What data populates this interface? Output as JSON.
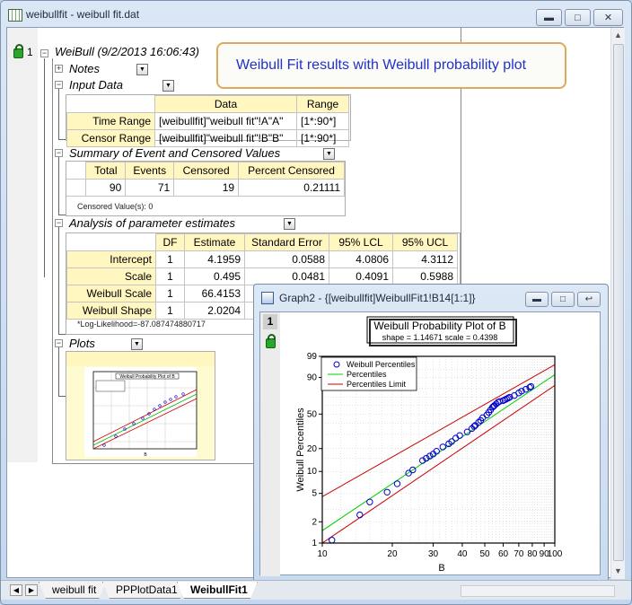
{
  "window": {
    "title": "weibullfit - weibull fit.dat"
  },
  "tree": {
    "root_index": "1",
    "root_label": "WeiBull (9/2/2013 16:06:43)",
    "notes": "Notes",
    "input_data": {
      "title": "Input Data",
      "headers": [
        "Data",
        "Range"
      ],
      "rows": [
        {
          "label": "Time Range",
          "data": "[weibullfit]\"weibull fit\"!A\"A\"",
          "range": "[1*:90*]"
        },
        {
          "label": "Censor Range",
          "data": "[weibullfit]\"weibull fit\"!B\"B\"",
          "range": "[1*:90*]"
        }
      ]
    },
    "summary": {
      "title": "Summary of Event and Censored Values",
      "headers": [
        "Total",
        "Events",
        "Censored",
        "Percent Censored"
      ],
      "values": [
        "90",
        "71",
        "19",
        "0.21111"
      ],
      "note": "Censored Value(s): 0"
    },
    "analysis": {
      "title": "Analysis of parameter estimates",
      "headers": [
        "DF",
        "Estimate",
        "Standard Error",
        "95% LCL",
        "95% UCL"
      ],
      "rows": [
        {
          "label": "Intercept",
          "cells": [
            "1",
            "4.1959",
            "0.0588",
            "4.0806",
            "4.3112"
          ]
        },
        {
          "label": "Scale",
          "cells": [
            "1",
            "0.495",
            "0.0481",
            "0.4091",
            "0.5988"
          ]
        },
        {
          "label": "Weibull Scale",
          "cells": [
            "1",
            "66.4153",
            "",
            "",
            ""
          ]
        },
        {
          "label": "Weibull Shape",
          "cells": [
            "1",
            "2.0204",
            "",
            "",
            ""
          ]
        }
      ],
      "note": "*Log-Likelihood=-87.087474880717"
    },
    "plots": "Plots"
  },
  "callout": "Weibull Fit results with Weibull probability plot",
  "graph": {
    "title": "Graph2 - {[weibullfit]WeibullFit1!B14[1:1]}",
    "layer": "1",
    "plot_title": "Weibull Probability Plot of B",
    "plot_subtitle": "shape = 1.14671  scale = 0.4398",
    "xlabel": "B",
    "ylabel": "Weibull Percentiles",
    "legend": [
      "Weibull Percentiles",
      "Percentiles",
      "Percentiles Limit"
    ]
  },
  "thumb": {
    "title": "Weibull Probability Plot of B",
    "xlabel": "B"
  },
  "colors": {
    "points": "#0000cc",
    "fit": "#00cc00",
    "limit": "#cc0000",
    "callout_border": "#e0a85a",
    "callout_text": "#2231c7",
    "header_fill": "#fff6c0"
  },
  "chart_data": {
    "type": "scatter",
    "title": "Weibull Probability Plot of B",
    "subtitle": "shape = 1.14671  scale = 0.4398",
    "xlabel": "B",
    "ylabel": "Weibull Percentiles",
    "x_scale": "log",
    "y_scale": "weibull probability",
    "xlim": [
      10,
      100
    ],
    "ylim": [
      1,
      99
    ],
    "x_ticks": [
      "10",
      "20",
      "30",
      "40",
      "50",
      "60",
      "70",
      "80",
      "90",
      "100"
    ],
    "y_ticks": [
      "1",
      "2",
      "5",
      "10",
      "20",
      "50",
      "90",
      "99"
    ],
    "legend_position": "top-left",
    "grid": true,
    "series": [
      {
        "name": "Weibull Percentiles",
        "kind": "points",
        "x": [
          11,
          14.5,
          16,
          19,
          21,
          23.5,
          24.5,
          27,
          28,
          29,
          30,
          31,
          33,
          35,
          36,
          37.5,
          39,
          42,
          44,
          45,
          45.5,
          47,
          48,
          49,
          51,
          52,
          53,
          54,
          54.5,
          55,
          56,
          57,
          58,
          60,
          61,
          62,
          63,
          64,
          67,
          70,
          72,
          75,
          78,
          79
        ],
        "y": [
          1.1,
          2.5,
          3.8,
          5.2,
          6.8,
          9.5,
          10.5,
          14,
          15,
          16,
          17,
          18.5,
          21,
          23,
          24.5,
          27,
          29,
          32,
          35,
          37,
          38,
          41,
          43,
          46,
          49,
          52,
          55,
          58,
          59,
          60,
          62,
          64,
          65,
          66,
          67,
          68,
          69,
          70,
          72,
          75,
          77,
          79,
          81,
          82
        ]
      },
      {
        "name": "Percentiles",
        "kind": "line",
        "x": [
          10,
          100
        ],
        "y": [
          1.5,
          92
        ]
      },
      {
        "name": "Percentiles Limit",
        "kind": "line",
        "x": [
          10,
          100
        ],
        "y": [
          4.5,
          97
        ]
      },
      {
        "name": "Percentiles Limit",
        "kind": "line",
        "x": [
          10,
          100
        ],
        "y": [
          1,
          83
        ]
      }
    ]
  }
}
